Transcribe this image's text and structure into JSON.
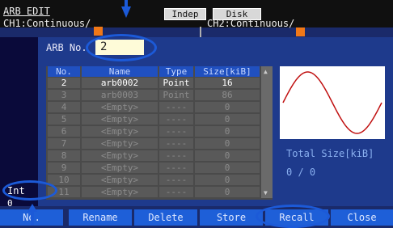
{
  "header": {
    "title": "ARB EDIT",
    "indep_label": "Indep",
    "disk_label": "Disk"
  },
  "channels": {
    "ch1": "CH1:Continuous/",
    "ch2": "CH2:Continuous/"
  },
  "arb_no": {
    "label": "ARB No.",
    "value": "2"
  },
  "table": {
    "columns": [
      "No.",
      "Name",
      "Type",
      "Size[kiB]"
    ],
    "rows": [
      {
        "no": "2",
        "name": "arb0002",
        "type": "Point",
        "size": "16"
      },
      {
        "no": "3",
        "name": "arb0003",
        "type": "Point",
        "size": "86"
      },
      {
        "no": "4",
        "name": "<Empty>",
        "type": "----",
        "size": "0"
      },
      {
        "no": "5",
        "name": "<Empty>",
        "type": "----",
        "size": "0"
      },
      {
        "no": "6",
        "name": "<Empty>",
        "type": "----",
        "size": "0"
      },
      {
        "no": "7",
        "name": "<Empty>",
        "type": "----",
        "size": "0"
      },
      {
        "no": "8",
        "name": "<Empty>",
        "type": "----",
        "size": "0"
      },
      {
        "no": "9",
        "name": "<Empty>",
        "type": "----",
        "size": "0"
      },
      {
        "no": "10",
        "name": "<Empty>",
        "type": "----",
        "size": "0"
      },
      {
        "no": "11",
        "name": "<Empty>",
        "type": "----",
        "size": "0"
      }
    ]
  },
  "preview": {
    "total_label": "Total Size[kiB]",
    "total_value": "0 / 0"
  },
  "left": {
    "int_label": "Int",
    "zero_label": "0"
  },
  "softkeys": [
    "No.",
    "Rename",
    "Delete",
    "Store",
    "Recall",
    "Close"
  ],
  "colors": {
    "accent": "#1e5fd8",
    "channel_indicator": "#f07818",
    "waveform": "#c01010",
    "input_bg": "#fefbd8"
  }
}
